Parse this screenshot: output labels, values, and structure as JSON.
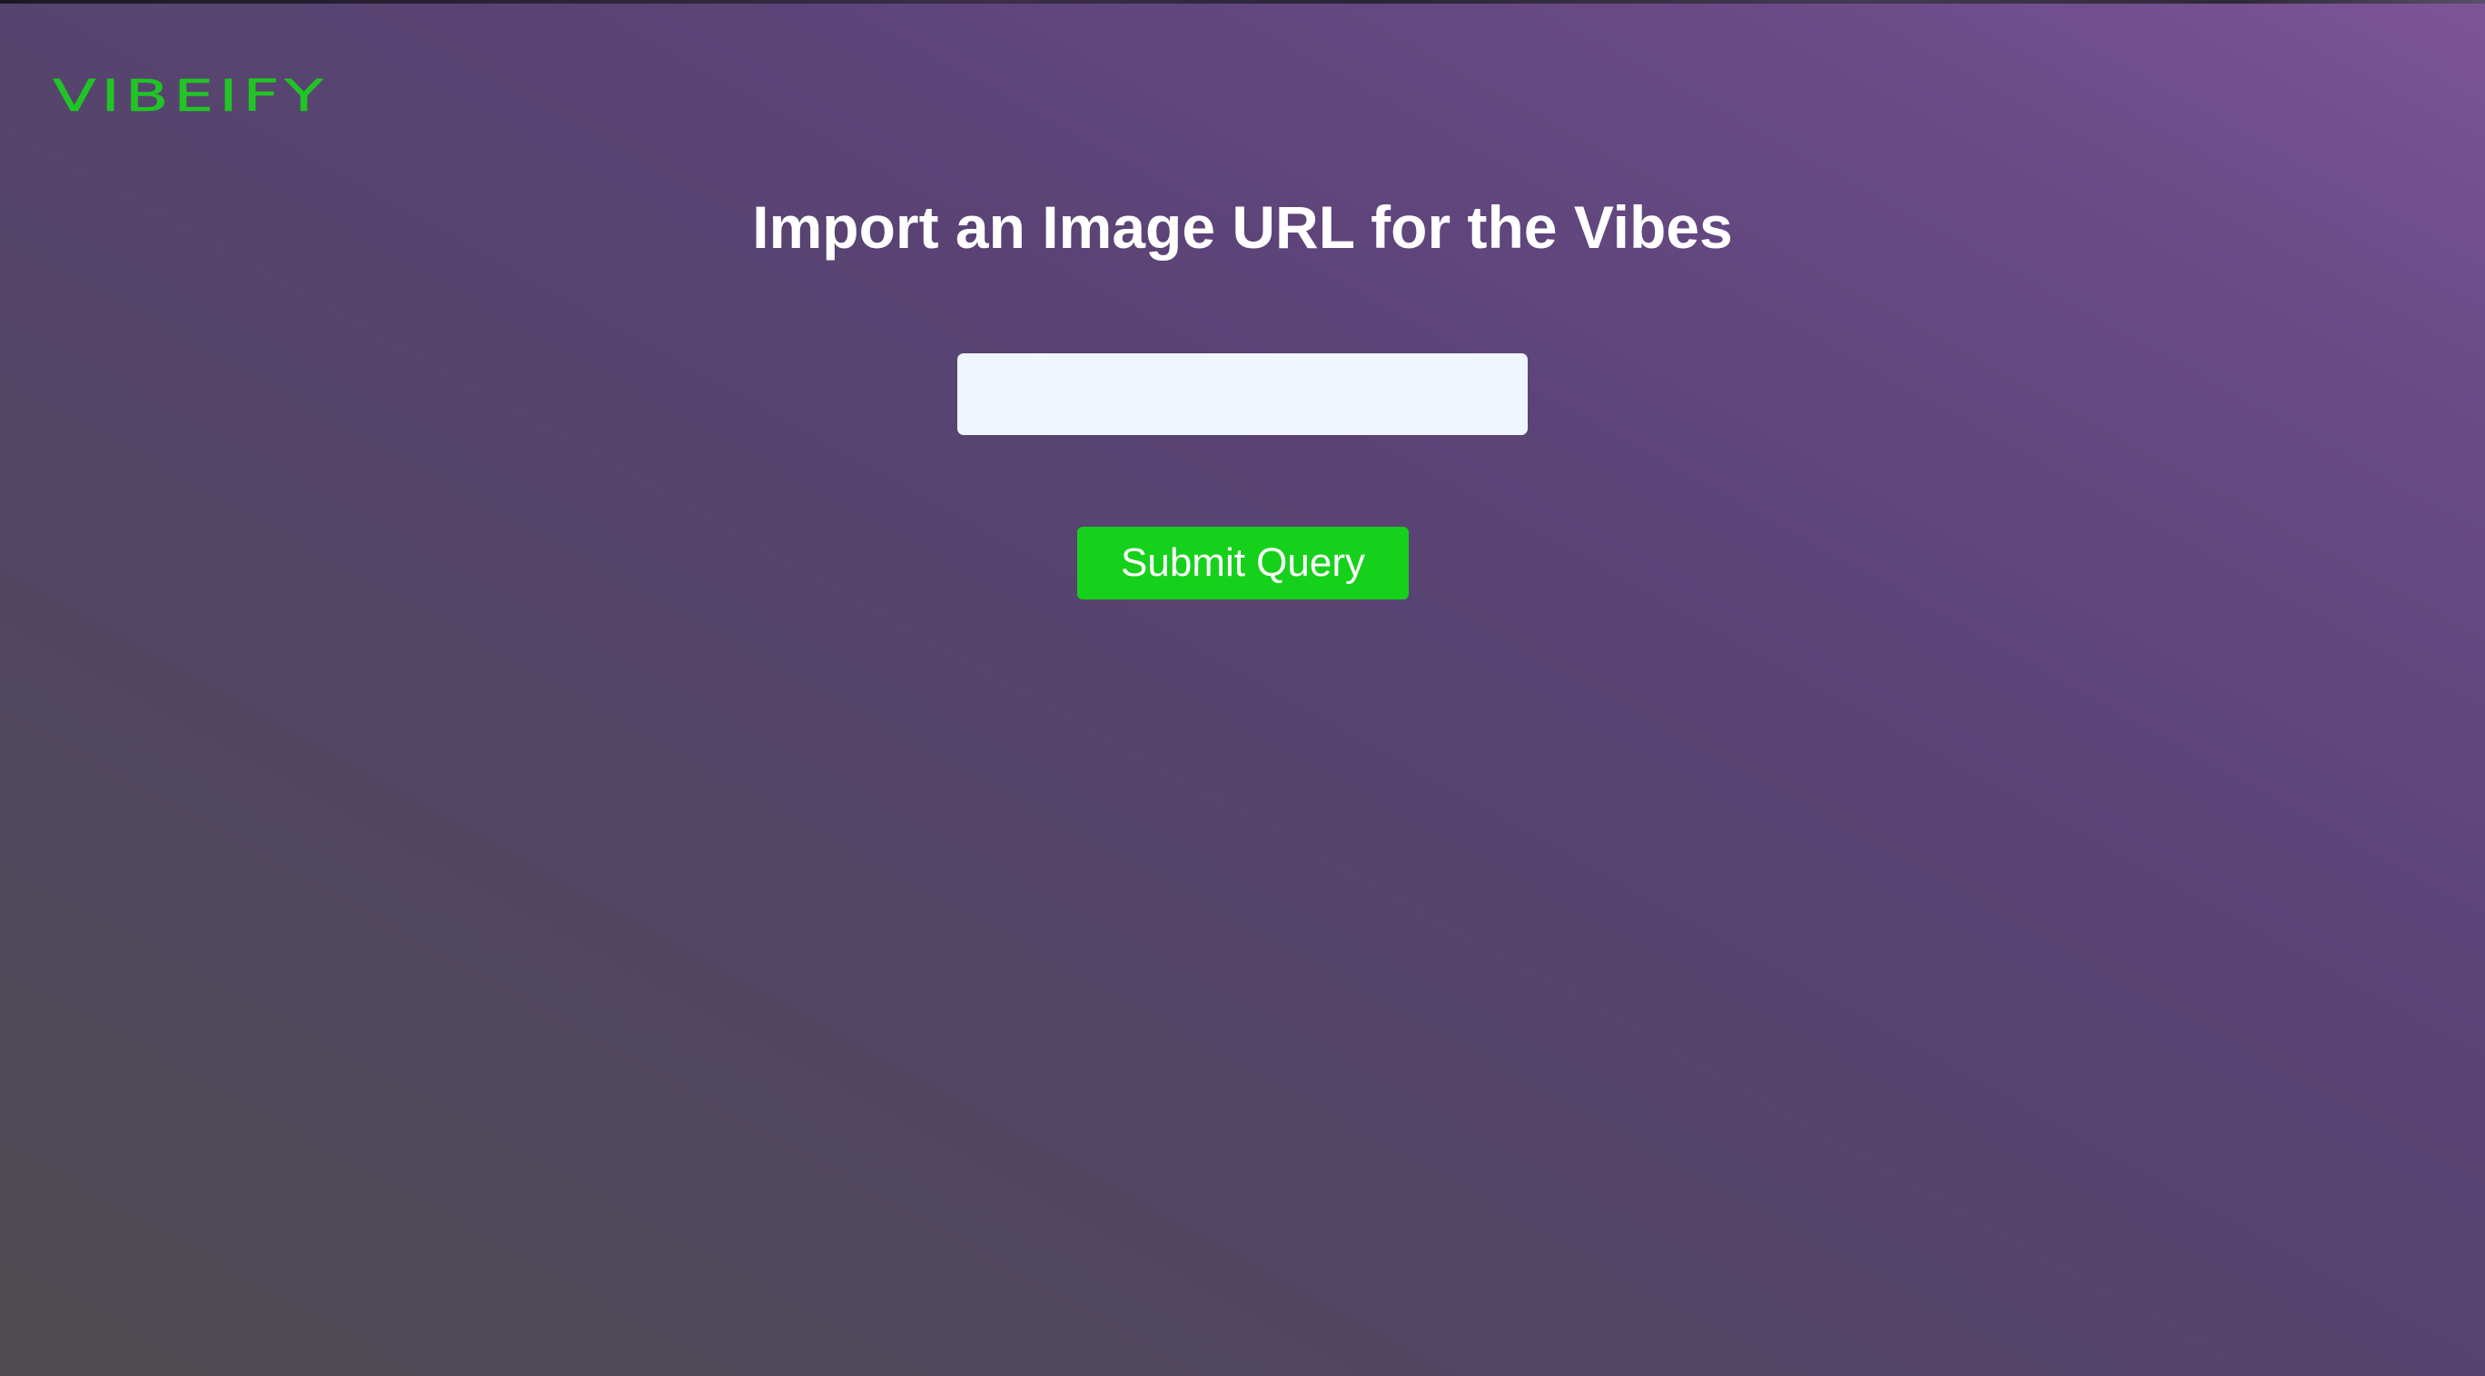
{
  "brand": {
    "logo_text": "VIBEIFY"
  },
  "main": {
    "title": "Import an Image URL for the Vibes",
    "url_input": {
      "value": "",
      "placeholder": ""
    },
    "submit_label": "Submit Query"
  },
  "colors": {
    "accent": "#16d11b",
    "logo": "#20c525",
    "input_background": "#f0f6ff",
    "background_purple": "#7d5497",
    "background_gray": "#4f4d50"
  }
}
